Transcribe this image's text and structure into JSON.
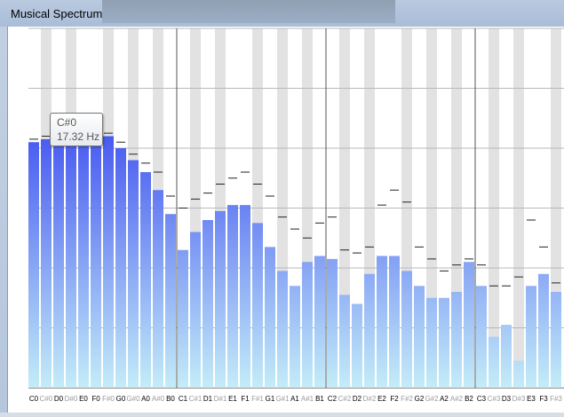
{
  "window": {
    "title": "Musical Spectrum"
  },
  "tooltip": {
    "note": "C#0",
    "frequency": "17.32 Hz"
  },
  "colors": {
    "bar_top": "#4050f0",
    "bar_bottom": "#c4ecf8",
    "black_key_band": "#e2e2e2",
    "peak_marker": "#222222",
    "grid": "#b8b8b8",
    "octave_line": "#555555"
  },
  "chart_data": {
    "type": "bar",
    "title": "",
    "xlabel": "",
    "ylabel": "",
    "ylim": [
      0,
      6
    ],
    "grid": true,
    "categories": [
      "C0",
      "C#0",
      "D0",
      "D#0",
      "E0",
      "F0",
      "F#0",
      "G0",
      "G#0",
      "A0",
      "A#0",
      "B0",
      "C1",
      "C#1",
      "D1",
      "D#1",
      "E1",
      "F1",
      "F#1",
      "G1",
      "G#1",
      "A1",
      "A#1",
      "B1",
      "C2",
      "C#2",
      "D2",
      "D#2",
      "E2",
      "F2",
      "F#2",
      "G2",
      "G#2",
      "A2",
      "A#2",
      "B2",
      "C3",
      "C#3",
      "D3",
      "D#3",
      "E3",
      "F3",
      "F#3"
    ],
    "black_keys": [
      "C#0",
      "D#0",
      "F#0",
      "G#0",
      "A#0",
      "C#1",
      "D#1",
      "F#1",
      "G#1",
      "A#1",
      "C#2",
      "D#2",
      "F#2",
      "G#2",
      "A#2",
      "C#3",
      "D#3",
      "F#3"
    ],
    "series": [
      {
        "values": [
          4.1,
          4.15,
          4.2,
          4.3,
          4.35,
          4.35,
          4.2,
          4.0,
          3.8,
          3.6,
          3.3,
          2.9,
          2.3,
          2.6,
          2.8,
          2.95,
          3.05,
          3.05,
          2.75,
          2.35,
          1.95,
          1.7,
          2.1,
          2.2,
          2.15,
          1.55,
          1.4,
          1.9,
          2.2,
          2.2,
          1.95,
          1.7,
          1.5,
          1.5,
          1.6,
          2.1,
          1.7,
          0.85,
          1.05,
          0.45,
          1.7,
          1.9,
          1.6
        ]
      },
      {
        "values": [
          4.15,
          4.2,
          4.25,
          4.35,
          4.4,
          4.4,
          4.25,
          4.1,
          3.9,
          3.75,
          3.6,
          3.2,
          3.0,
          3.15,
          3.25,
          3.4,
          3.5,
          3.6,
          3.4,
          3.2,
          2.85,
          2.65,
          2.5,
          2.75,
          2.85,
          2.3,
          2.25,
          2.35,
          3.05,
          3.3,
          3.1,
          2.35,
          2.15,
          1.95,
          2.05,
          2.15,
          2.05,
          1.7,
          1.7,
          1.85,
          2.8,
          2.35,
          1.75
        ]
      }
    ]
  },
  "axis": {
    "octave_labels": [
      {
        "note": "C0",
        "index": 0
      },
      {
        "note": "C1",
        "index": 12
      },
      {
        "note": "C2",
        "index": 24
      },
      {
        "note": "C3",
        "index": 36
      }
    ]
  }
}
